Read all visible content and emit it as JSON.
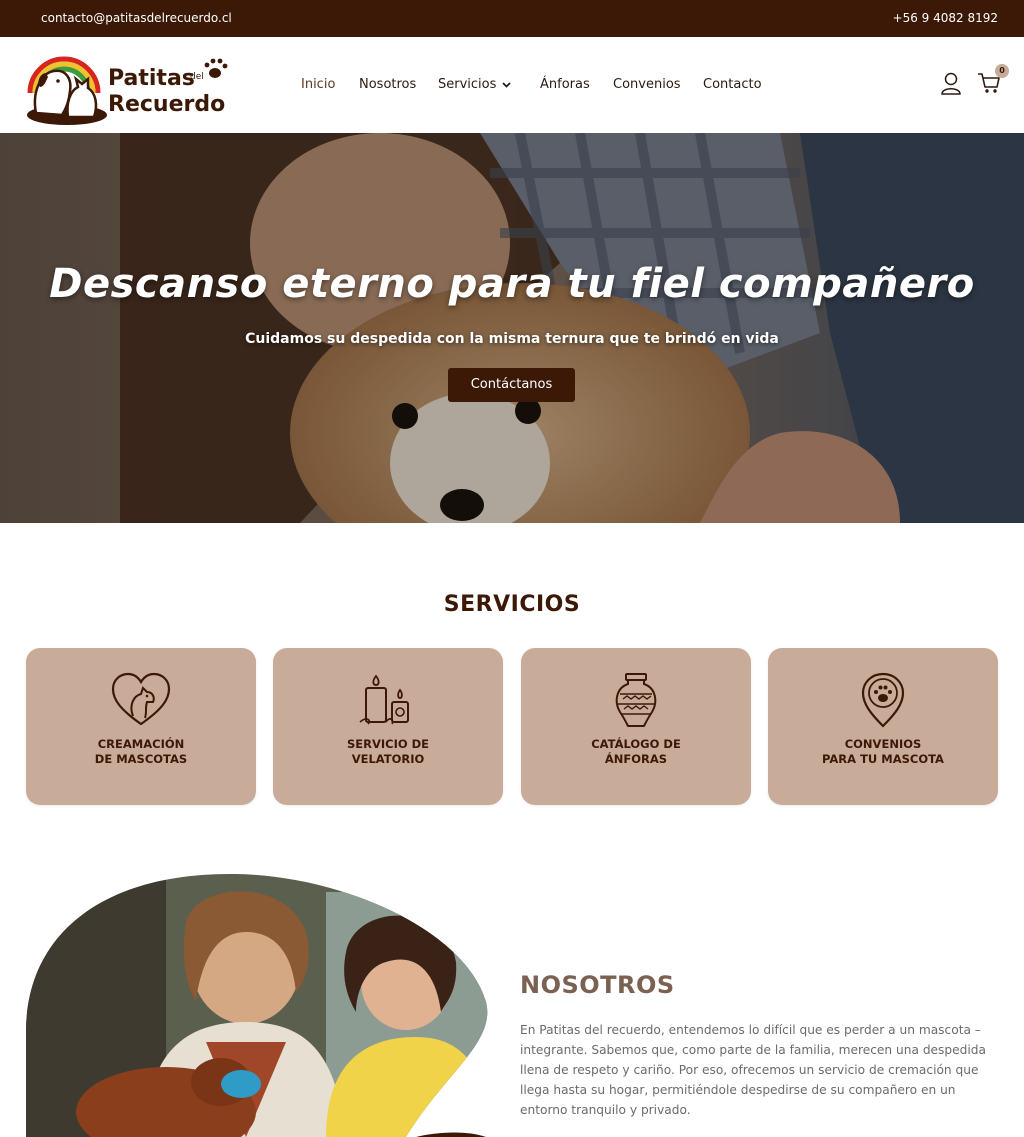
{
  "topbar": {
    "email": "contacto@patitasdelrecuerdo.cl",
    "phone": "+56 9 4082 8192"
  },
  "logo": {
    "text_line1": "Patitas",
    "text_small": "del",
    "text_line2": "Recuerdo"
  },
  "nav": {
    "items": [
      {
        "label": "Inicio",
        "active": true
      },
      {
        "label": "Nosotros"
      },
      {
        "label": "Servicios",
        "has_dropdown": true
      },
      {
        "label": "Ánforas"
      },
      {
        "label": "Convenios"
      },
      {
        "label": "Contacto"
      }
    ]
  },
  "cart": {
    "count": "0",
    "icon": "cart-icon"
  },
  "user": {
    "icon": "user-icon"
  },
  "hero": {
    "title": "Descanso eterno para tu fiel compañero",
    "subtitle": "Cuidamos su despedida con la misma ternura que te brindó en vida",
    "button": "Contáctanos"
  },
  "services": {
    "title": "SERVICIOS",
    "cards": [
      {
        "line1": "CREAMACIÓN",
        "line2": "DE MASCOTAS",
        "icon": "heart-pet-icon"
      },
      {
        "line1": "SERVICIO DE",
        "line2": "VELATORIO",
        "icon": "candles-icon"
      },
      {
        "line1": "CATÁLOGO DE",
        "line2": "ÁNFORAS",
        "icon": "urn-icon"
      },
      {
        "line1": "CONVENIOS",
        "line2": "PARA TU MASCOTA",
        "icon": "paw-pin-icon"
      }
    ]
  },
  "about": {
    "title": "NOSOTROS",
    "text": "En Patitas del recuerdo, entendemos lo difícil que es perder a un mascota – integrante. Sabemos que, como parte de la familia, merecen una despedida llena de respeto y cariño. Por eso, ofrecemos un servicio de cremación que llega hasta su hogar, permitiéndole despedirse de su compañero en un entorno tranquilo y privado."
  },
  "colors": {
    "brand_dark": "#3b1906",
    "card_bg": "#c8ab98",
    "about_title": "#7a6152"
  }
}
